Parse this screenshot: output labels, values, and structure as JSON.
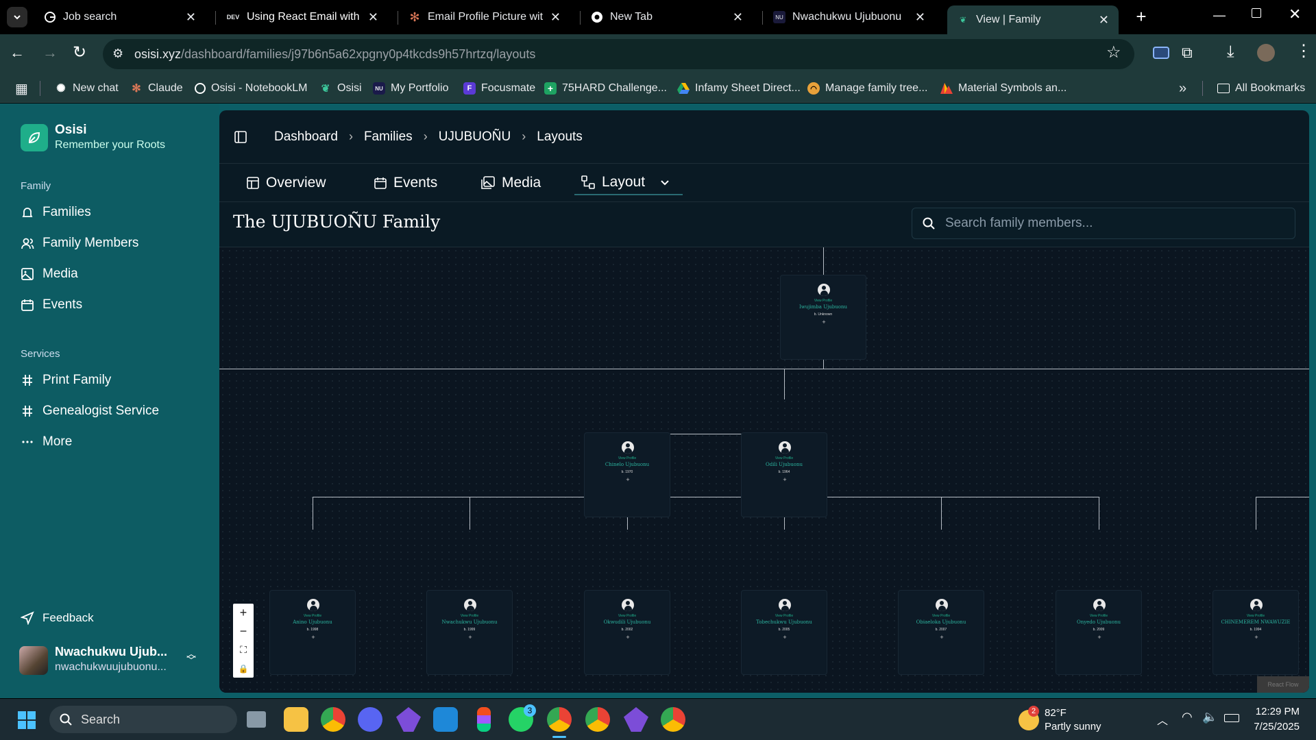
{
  "browser": {
    "tabs": [
      {
        "title": "Job search",
        "icon": "google-g-icon"
      },
      {
        "title": "Using React Email with the",
        "icon": "dev-icon",
        "icon_text": "DEV"
      },
      {
        "title": "Email Profile Picture with R",
        "icon": "claude-icon"
      },
      {
        "title": "New Tab",
        "icon": "chrome-icon"
      },
      {
        "title": "Nwachukwu Ujubuonu",
        "icon": "nu-icon",
        "icon_text": "NU"
      },
      {
        "title": "View | Family",
        "icon": "osisi-leaf-icon",
        "active": true
      }
    ],
    "url_host": "osisi.xyz",
    "url_path": "/dashboard/families/j97b6n5a62xpgny0p4tkcds9h57hrtzq/layouts",
    "bookmarks": [
      {
        "label": "New chat",
        "icon": "openai-icon"
      },
      {
        "label": "Claude",
        "icon": "claude-icon"
      },
      {
        "label": "Osisi - NotebookLM",
        "icon": "notebooklm-icon"
      },
      {
        "label": "Osisi",
        "icon": "osisi-leaf-icon"
      },
      {
        "label": "My Portfolio",
        "icon": "nu-icon"
      },
      {
        "label": "Focusmate",
        "icon": "focusmate-icon",
        "icon_text": "F"
      },
      {
        "label": "75HARD Challenge...",
        "icon": "sheets-icon"
      },
      {
        "label": "Infamy Sheet Direct...",
        "icon": "drive-icon"
      },
      {
        "label": "Manage family tree...",
        "icon": "ancestry-icon"
      },
      {
        "label": "Material Symbols an...",
        "icon": "material-icon"
      }
    ],
    "all_bookmarks": "All Bookmarks"
  },
  "app": {
    "brand_name": "Osisi",
    "brand_tagline": "Remember your Roots",
    "sidebar": {
      "family_heading": "Family",
      "family_items": [
        {
          "label": "Families",
          "icon": "bell-icon"
        },
        {
          "label": "Family Members",
          "icon": "users-icon"
        },
        {
          "label": "Media",
          "icon": "image-icon"
        },
        {
          "label": "Events",
          "icon": "calendar-icon"
        }
      ],
      "services_heading": "Services",
      "services_items": [
        {
          "label": "Print Family",
          "icon": "hash-icon"
        },
        {
          "label": "Genealogist Service",
          "icon": "hash-icon"
        },
        {
          "label": "More",
          "icon": "more-horizontal-icon"
        }
      ],
      "feedback": "Feedback",
      "user_name": "Nwachukwu Ujub...",
      "user_email": "nwachukwuujubuonu..."
    },
    "breadcrumb": [
      "Dashboard",
      "Families",
      "UJUBUOÑU",
      "Layouts"
    ],
    "tabs": [
      {
        "label": "Overview",
        "icon": "layout-icon"
      },
      {
        "label": "Events",
        "icon": "calendar-icon"
      },
      {
        "label": "Media",
        "icon": "images-icon"
      },
      {
        "label": "Layout",
        "icon": "workflow-icon",
        "active": true
      }
    ],
    "family_title": "The UJUBUOÑU Family",
    "search_placeholder": "Search family members...",
    "tree": {
      "view_profile": "View Profile",
      "nodes": [
        {
          "name": "Iwujimba Ujubuonu",
          "birth": "b. Unknown"
        },
        {
          "name": "Chinelo Ujubuonu",
          "birth": "b. 1970"
        },
        {
          "name": "Odili Ujubuonu",
          "birth": "b. 1964"
        },
        {
          "name": "Anino Ujubuonu",
          "birth": "b. 1998"
        },
        {
          "name": "Nwachukwu Ujubuonu",
          "birth": "b. 1999"
        },
        {
          "name": "Okwudili Ujubuonu",
          "birth": "b. 2002"
        },
        {
          "name": "Tobechukwu Ujubuonu",
          "birth": "b. 2005"
        },
        {
          "name": "Obiaeloka Ujubuonu",
          "birth": "b. 2007"
        },
        {
          "name": "Onyedo Ujubuonu",
          "birth": "b. 2009"
        },
        {
          "name": "CHINEMEREM NWAWUZIE",
          "birth": "b. 1994"
        }
      ]
    },
    "zoom_controls": [
      "+",
      "−",
      "⛶",
      "🔒"
    ],
    "attribution": "React Flow"
  },
  "taskbar": {
    "search": "Search",
    "weather_temp": "82°F",
    "weather_desc": "Partly sunny",
    "weather_badge": "2",
    "whatsapp_badge": "3",
    "time": "12:29 PM",
    "date": "7/25/2025"
  }
}
